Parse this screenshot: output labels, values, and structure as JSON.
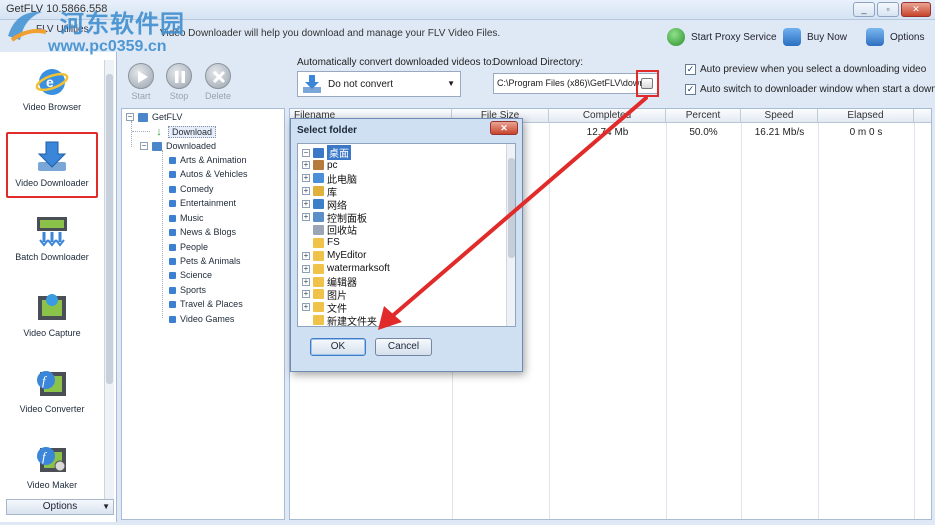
{
  "window": {
    "title": "GetFLV 10.5866.558",
    "tab_name": "FLV Utilities",
    "minimize": "_",
    "maximize": "▫",
    "close": "✕"
  },
  "watermark": {
    "name": "河东软件园",
    "url": "www.pc0359.cn"
  },
  "header": {
    "description": "Video Downloader will help you download and manage your FLV Video Files.",
    "proxy_label": "Start Proxy Service",
    "buy_label": "Buy Now",
    "options_label": "Options"
  },
  "sidebar": {
    "items": [
      {
        "label": "Video Browser"
      },
      {
        "label": "Video Downloader"
      },
      {
        "label": "Batch Downloader"
      },
      {
        "label": "Video Capture"
      },
      {
        "label": "Video Converter"
      },
      {
        "label": "Video Maker"
      }
    ],
    "options_label": "Options"
  },
  "toolbar": {
    "start_label": "Start",
    "stop_label": "Stop",
    "delete_label": "Delete",
    "convert_label": "Automatically convert downloaded videos to:",
    "convert_value": "Do not convert",
    "dir_label": "Download Directory:",
    "dir_value": "C:\\Program Files (x86)\\GetFLV\\down",
    "auto_preview_label": "Auto preview when you select a downloading video",
    "auto_switch_label": "Auto switch to downloader window when start a download",
    "auto_preview_checked": true,
    "auto_switch_checked": true
  },
  "tree": {
    "root": "GetFLV",
    "download": "Download",
    "downloaded": "Downloaded",
    "categories": [
      "Arts & Animation",
      "Autos & Vehicles",
      "Comedy",
      "Entertainment",
      "Music",
      "News & Blogs",
      "People",
      "Pets & Animals",
      "Science",
      "Sports",
      "Travel & Places",
      "Video Games"
    ]
  },
  "table": {
    "columns": [
      "Filename",
      "File Size",
      "Completed",
      "Percent",
      "Speed",
      "Elapsed"
    ],
    "rows": [
      {
        "completed": "12.74 Mb",
        "percent": "50.0%",
        "speed": "16.21 Mb/s",
        "elapsed": "0 m 0 s"
      }
    ]
  },
  "dialog": {
    "title": "Select folder",
    "close": "✕",
    "ok": "OK",
    "cancel": "Cancel",
    "folders": [
      {
        "label": "桌面",
        "expand": "−",
        "icon": "desktop-icon",
        "color": "#3b79c8",
        "selected": true
      },
      {
        "label": "pc",
        "expand": "+",
        "icon": "user-icon",
        "color": "#b77a3c"
      },
      {
        "label": "此电脑",
        "expand": "+",
        "icon": "computer-icon",
        "color": "#4a90d9"
      },
      {
        "label": "库",
        "expand": "+",
        "icon": "library-icon",
        "color": "#e0b23c"
      },
      {
        "label": "网络",
        "expand": "+",
        "icon": "network-icon",
        "color": "#3b7fc9"
      },
      {
        "label": "控制面板",
        "expand": "+",
        "icon": "control-panel-icon",
        "color": "#5a8fc8"
      },
      {
        "label": "回收站",
        "expand": "",
        "icon": "recycle-bin-icon",
        "color": "#9aa6b4"
      },
      {
        "label": "FS",
        "expand": "",
        "icon": "folder-icon",
        "color": "#f0c24a"
      },
      {
        "label": "MyEditor",
        "expand": "+",
        "icon": "folder-icon",
        "color": "#f0c24a"
      },
      {
        "label": "watermarksoft",
        "expand": "+",
        "icon": "folder-icon",
        "color": "#f0c24a"
      },
      {
        "label": "编辑器",
        "expand": "+",
        "icon": "folder-icon",
        "color": "#f0c24a"
      },
      {
        "label": "图片",
        "expand": "+",
        "icon": "folder-icon",
        "color": "#f0c24a"
      },
      {
        "label": "文件",
        "expand": "+",
        "icon": "folder-icon",
        "color": "#f0c24a"
      },
      {
        "label": "新建文件夹",
        "expand": "",
        "icon": "folder-icon",
        "color": "#f0c24a"
      }
    ]
  },
  "colors": {
    "highlight_red": "#e12a2a",
    "selection_blue": "#3b79c8",
    "folder_yellow": "#f0c24a"
  }
}
